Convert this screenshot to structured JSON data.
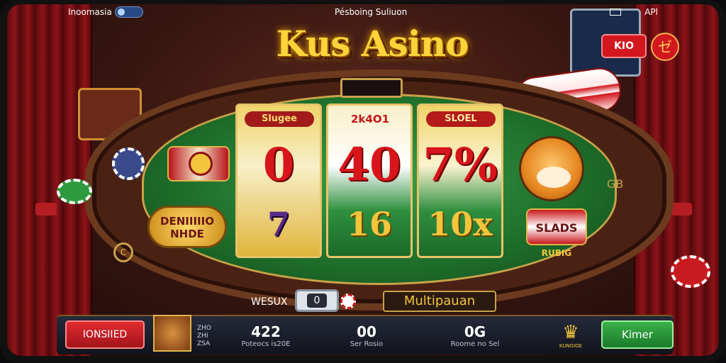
{
  "status_bar": {
    "left_label": "Inoomasia",
    "center_label": "Pésboing Suliuon",
    "right_label": "APl"
  },
  "title": "Kus Asino",
  "reels": [
    {
      "label": "Slugee",
      "top_symbol": "0",
      "bottom_symbol": "7"
    },
    {
      "label": "2k4O1",
      "top_symbol": "40",
      "bottom_symbol": "16"
    },
    {
      "label": "SLOEL",
      "top_symbol": "7%",
      "bottom_symbol": "10x"
    }
  ],
  "left_badge": {
    "label_line1": "DENIIIIIO",
    "label_line2": "NHDE"
  },
  "right_badge": {
    "label": "SLADS",
    "caption": "RUBIG"
  },
  "hud": {
    "red_button": "KIO",
    "circle_button": "ゼ"
  },
  "bet": {
    "label": "WESUX",
    "value": "0"
  },
  "multiplier_label": "Multipauan",
  "bottom_panel": {
    "left_button": "IONSIIED",
    "avatar_text": [
      "ZHO",
      "ZHI",
      "ZSA"
    ],
    "stats": [
      {
        "value": "422",
        "label": "Poteocs is20E"
      },
      {
        "value": "00",
        "label": "Ser Rosio"
      },
      {
        "value": "0G",
        "label": "Roome no Sel"
      }
    ],
    "crown_label": "KUNGIOE",
    "right_button": "Kimer"
  },
  "side_labels": {
    "gb": "GB",
    "corner": "C"
  },
  "colors": {
    "accent": "#f3c53c",
    "felt": "#2f8f3e",
    "red": "#d2171e"
  }
}
